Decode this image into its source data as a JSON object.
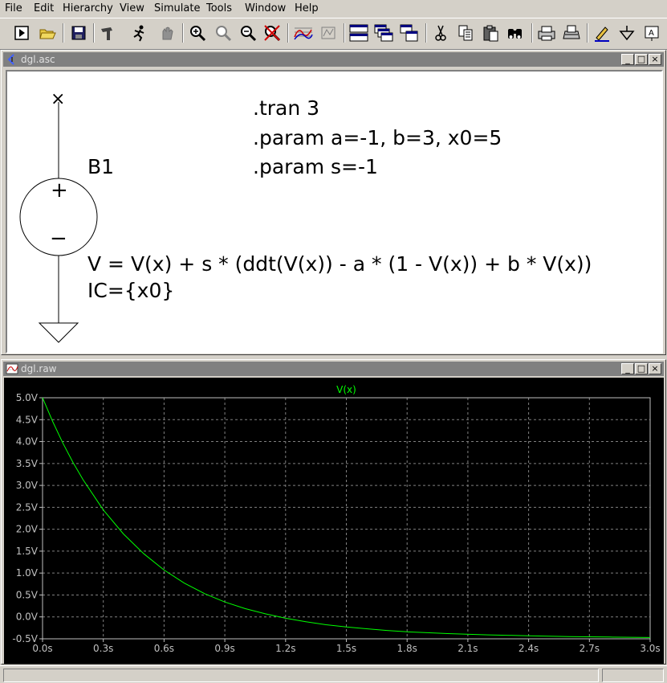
{
  "menu": [
    {
      "label": "File"
    },
    {
      "label": "Edit"
    },
    {
      "label": "Hierarchy"
    },
    {
      "label": "View"
    },
    {
      "label": "Simulate"
    },
    {
      "label": "Tools"
    },
    {
      "label": "Window"
    },
    {
      "label": "Help"
    }
  ],
  "toolbar_icons": [
    "new-schematic-icon",
    "open-icon",
    "save-icon",
    "control-panel-icon",
    "run-icon",
    "halt-icon",
    "zoom-in-icon",
    "zoom-pan-icon",
    "zoom-out-icon",
    "zoom-cancel-icon",
    "autorange-icon",
    "fft-icon",
    "tile-horizontal-icon",
    "cascade-icon",
    "tile-vertical-icon",
    "cut-icon",
    "copy-icon",
    "paste-icon",
    "find-icon",
    "print-preview-icon",
    "print-icon",
    "draw-wire-icon",
    "ground-icon",
    "label-net-icon"
  ],
  "schematic_window": {
    "title": "dgl.asc",
    "x_marker": "×",
    "component_name": "B1",
    "directives": [
      ".tran 3",
      ".param a=-1, b=3, x0=5",
      ".param s=-1"
    ],
    "expression": "V = V(x) + s * (ddt(V(x)) - a * (1 - V(x)) + b * V(x))",
    "initial_condition": "IC={x0}",
    "plus_sign": "+",
    "minus_sign": "−"
  },
  "waveform_window": {
    "title": "dgl.raw",
    "trace_label": "V(x)",
    "trace_color": "#00ff00",
    "background": "#000000",
    "axis_color": "#c0c0c0"
  },
  "chart_data": {
    "type": "line",
    "series": [
      {
        "name": "V(x)",
        "x": [
          0,
          0.05,
          0.1,
          0.15,
          0.2,
          0.3,
          0.4,
          0.5,
          0.6,
          0.7,
          0.8,
          0.9,
          1.0,
          1.1,
          1.2,
          1.3,
          1.4,
          1.5,
          1.6,
          1.7,
          1.8,
          1.9,
          2.0,
          2.2,
          2.4,
          2.6,
          2.8,
          3.0
        ],
        "y": [
          5.0,
          4.46,
          3.97,
          3.53,
          3.13,
          2.44,
          1.89,
          1.44,
          1.07,
          0.77,
          0.53,
          0.34,
          0.19,
          0.07,
          -0.03,
          -0.11,
          -0.18,
          -0.23,
          -0.27,
          -0.31,
          -0.34,
          -0.36,
          -0.38,
          -0.41,
          -0.43,
          -0.45,
          -0.46,
          -0.47
        ]
      }
    ],
    "xlim": [
      0,
      3.0
    ],
    "ylim": [
      -0.5,
      5.0
    ],
    "x_ticks": [
      "0.0s",
      "0.3s",
      "0.6s",
      "0.9s",
      "1.2s",
      "1.5s",
      "1.8s",
      "2.1s",
      "2.4s",
      "2.7s",
      "3.0s"
    ],
    "y_ticks": [
      "5.0V",
      "4.5V",
      "4.0V",
      "3.5V",
      "3.0V",
      "2.5V",
      "2.0V",
      "1.5V",
      "1.0V",
      "0.5V",
      "0.0V",
      "-0.5V"
    ],
    "grid": true
  }
}
